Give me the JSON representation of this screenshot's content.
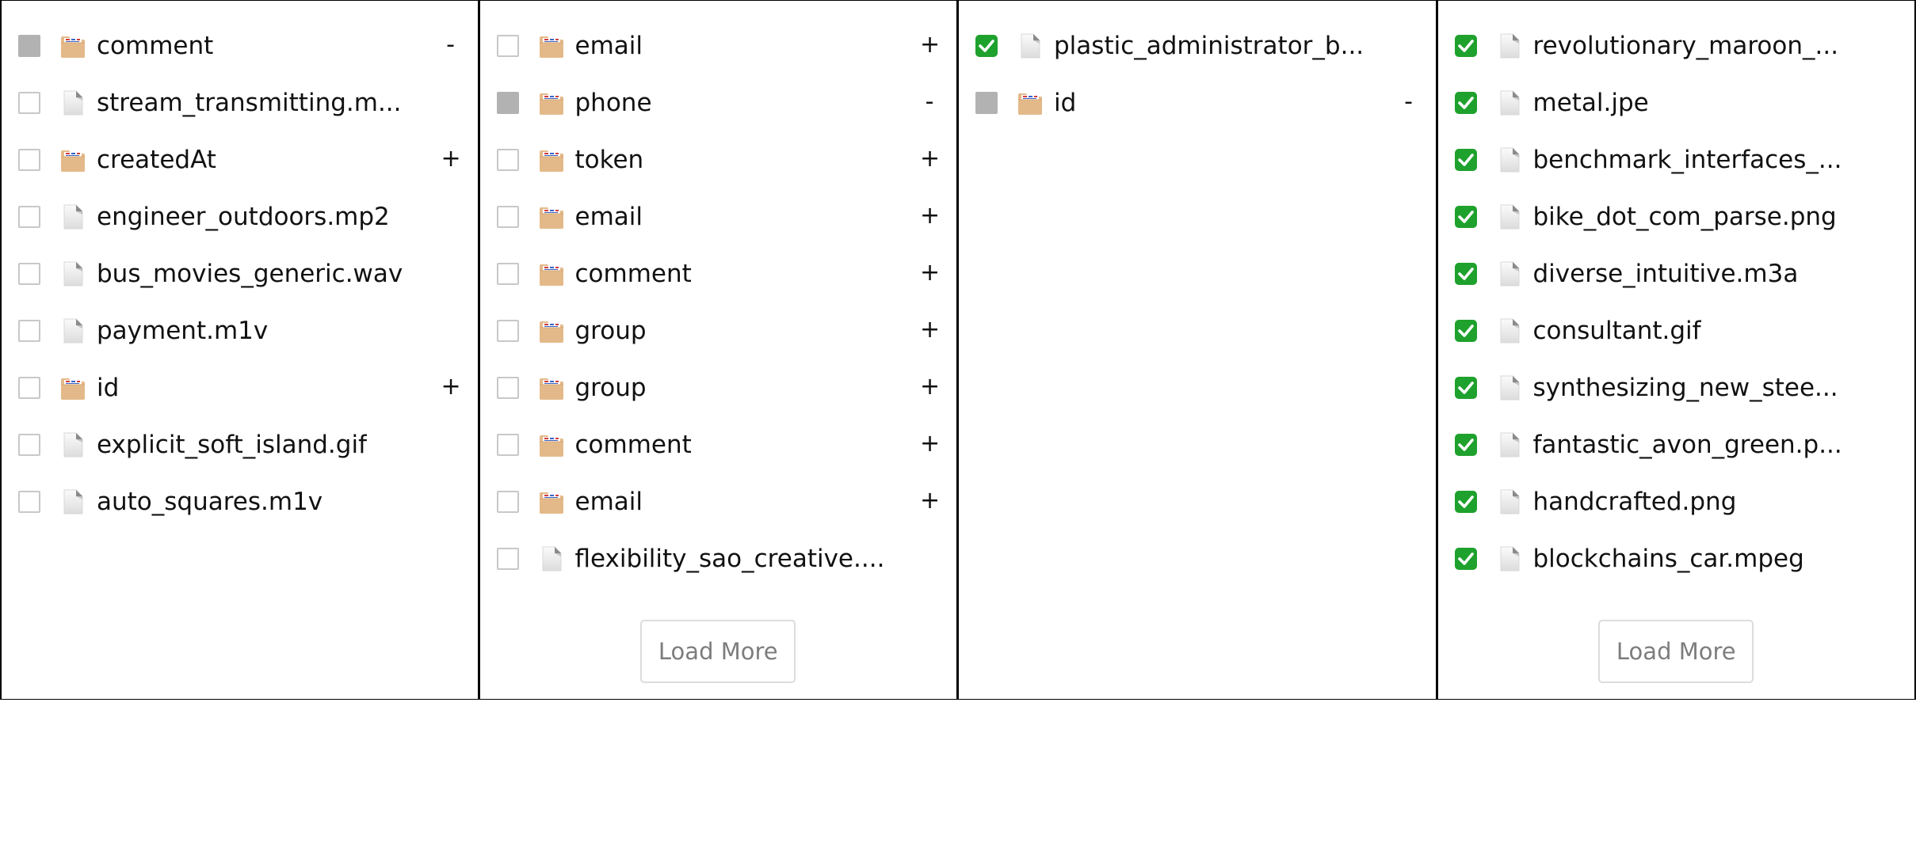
{
  "columns": [
    {
      "items": [
        {
          "label": "comment",
          "type": "folder",
          "checkbox": "partial",
          "toggle": "-"
        },
        {
          "label": "stream_transmitting.m...",
          "type": "file",
          "checkbox": "unchecked",
          "toggle": ""
        },
        {
          "label": "createdAt",
          "type": "folder",
          "checkbox": "unchecked",
          "toggle": "+"
        },
        {
          "label": "engineer_outdoors.mp2",
          "type": "file",
          "checkbox": "unchecked",
          "toggle": ""
        },
        {
          "label": "bus_movies_generic.wav",
          "type": "file",
          "checkbox": "unchecked",
          "toggle": ""
        },
        {
          "label": "payment.m1v",
          "type": "file",
          "checkbox": "unchecked",
          "toggle": ""
        },
        {
          "label": "id",
          "type": "folder",
          "checkbox": "unchecked",
          "toggle": "+"
        },
        {
          "label": "explicit_soft_island.gif",
          "type": "file",
          "checkbox": "unchecked",
          "toggle": ""
        },
        {
          "label": "auto_squares.m1v",
          "type": "file",
          "checkbox": "unchecked",
          "toggle": ""
        }
      ],
      "load_more_label": ""
    },
    {
      "items": [
        {
          "label": "email",
          "type": "folder",
          "checkbox": "unchecked",
          "toggle": "+"
        },
        {
          "label": "phone",
          "type": "folder",
          "checkbox": "partial",
          "toggle": "-"
        },
        {
          "label": "token",
          "type": "folder",
          "checkbox": "unchecked",
          "toggle": "+"
        },
        {
          "label": "email",
          "type": "folder",
          "checkbox": "unchecked",
          "toggle": "+"
        },
        {
          "label": "comment",
          "type": "folder",
          "checkbox": "unchecked",
          "toggle": "+"
        },
        {
          "label": "group",
          "type": "folder",
          "checkbox": "unchecked",
          "toggle": "+"
        },
        {
          "label": "group",
          "type": "folder",
          "checkbox": "unchecked",
          "toggle": "+"
        },
        {
          "label": "comment",
          "type": "folder",
          "checkbox": "unchecked",
          "toggle": "+"
        },
        {
          "label": "email",
          "type": "folder",
          "checkbox": "unchecked",
          "toggle": "+"
        },
        {
          "label": "flexibility_sao_creative....",
          "type": "file",
          "checkbox": "unchecked",
          "toggle": ""
        }
      ],
      "load_more_label": "Load More"
    },
    {
      "items": [
        {
          "label": "plastic_administrator_b...",
          "type": "file",
          "checkbox": "checked",
          "toggle": ""
        },
        {
          "label": "id",
          "type": "folder",
          "checkbox": "partial",
          "toggle": "-"
        }
      ],
      "load_more_label": ""
    },
    {
      "items": [
        {
          "label": "revolutionary_maroon_...",
          "type": "file",
          "checkbox": "checked",
          "toggle": ""
        },
        {
          "label": "metal.jpe",
          "type": "file",
          "checkbox": "checked",
          "toggle": ""
        },
        {
          "label": "benchmark_interfaces_...",
          "type": "file",
          "checkbox": "checked",
          "toggle": ""
        },
        {
          "label": "bike_dot_com_parse.png",
          "type": "file",
          "checkbox": "checked",
          "toggle": ""
        },
        {
          "label": "diverse_intuitive.m3a",
          "type": "file",
          "checkbox": "checked",
          "toggle": ""
        },
        {
          "label": "consultant.gif",
          "type": "file",
          "checkbox": "checked",
          "toggle": ""
        },
        {
          "label": "synthesizing_new_stee...",
          "type": "file",
          "checkbox": "checked",
          "toggle": ""
        },
        {
          "label": "fantastic_avon_green.p...",
          "type": "file",
          "checkbox": "checked",
          "toggle": ""
        },
        {
          "label": "handcrafted.png",
          "type": "file",
          "checkbox": "checked",
          "toggle": ""
        },
        {
          "label": "blockchains_car.mpeg",
          "type": "file",
          "checkbox": "checked",
          "toggle": ""
        }
      ],
      "load_more_label": "Load More"
    }
  ],
  "icons": {
    "folder": "folder-icon",
    "file": "file-icon"
  },
  "colors": {
    "border": "#000000",
    "checkbox_border": "#c8c8c8",
    "checkbox_partial": "#b2b2b2",
    "checkbox_checked": "#1fa12d",
    "folder": "#e4b98a",
    "load_more_text": "#7d7d7d",
    "load_more_border": "#dcdcdc"
  }
}
